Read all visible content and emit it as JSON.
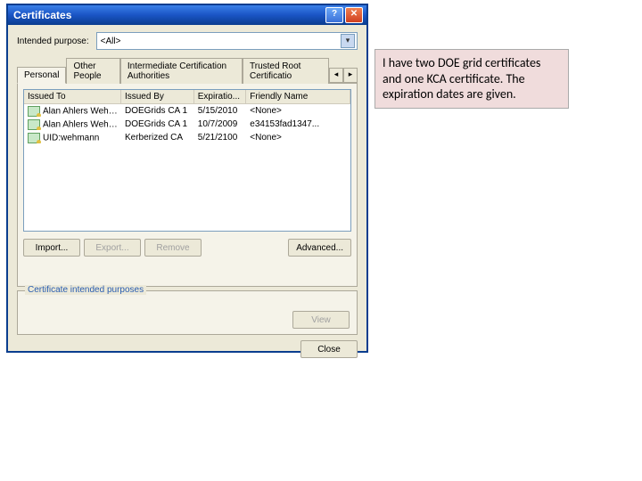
{
  "title": "Certificates",
  "purpose_label": "Intended purpose:",
  "purpose_value": "<All>",
  "tabs": {
    "personal": "Personal",
    "other_people": "Other People",
    "intermediate": "Intermediate Certification Authorities",
    "trusted_root": "Trusted Root Certificatio"
  },
  "columns": {
    "issued_to": "Issued To",
    "issued_by": "Issued By",
    "expiration": "Expiratio...",
    "friendly": "Friendly Name"
  },
  "rows": [
    {
      "issued_to": "Alan Ahlers Wehma...",
      "issued_by": "DOEGrids CA 1",
      "expiration": "5/15/2010",
      "friendly": "<None>"
    },
    {
      "issued_to": "Alan Ahlers Wehma...",
      "issued_by": "DOEGrids CA 1",
      "expiration": "10/7/2009",
      "friendly": "e34153fad1347..."
    },
    {
      "issued_to": "UID:wehmann",
      "issued_by": "Kerberized CA",
      "expiration": "5/21/2100",
      "friendly": "<None>"
    }
  ],
  "buttons": {
    "import": "Import...",
    "export": "Export...",
    "remove": "Remove",
    "advanced": "Advanced...",
    "view": "View",
    "close": "Close"
  },
  "fieldset_legend": "Certificate intended purposes",
  "annotation_text": "I have two DOE grid certificates and one KCA certificate.  The expiration dates are given."
}
